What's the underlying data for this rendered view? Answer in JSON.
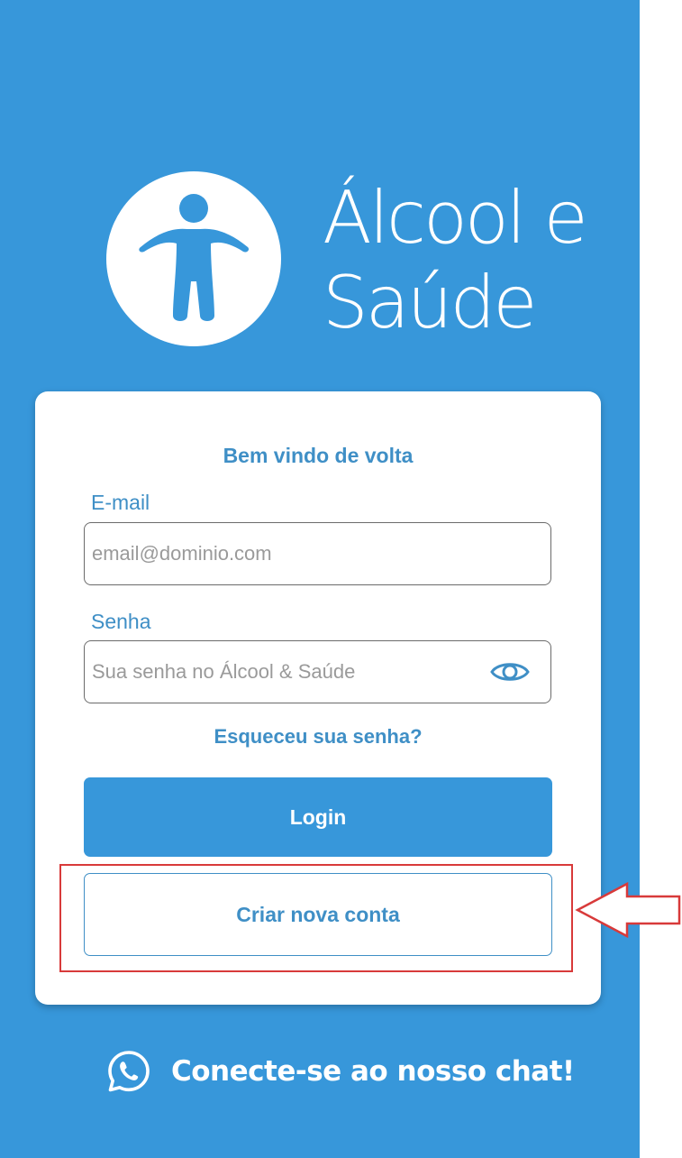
{
  "app": {
    "logo_line1": "Álcool e",
    "logo_line2": "Saúde"
  },
  "login_card": {
    "welcome": "Bem vindo de volta",
    "email_label": "E-mail",
    "email_placeholder": "email@dominio.com",
    "email_value": "",
    "password_label": "Senha",
    "password_placeholder": "Sua senha no Álcool & Saúde",
    "password_value": "",
    "password_toggle_icon": "eye-icon",
    "forgot_link": "Esqueceu sua senha?",
    "login_button": "Login",
    "create_account_button": "Criar nova conta"
  },
  "footer": {
    "chat_icon": "whatsapp-icon",
    "chat_link": "Conecte-se ao nosso chat!"
  },
  "annotation": {
    "highlight_color": "#d83a3a",
    "arrow_icon": "left-arrow-icon"
  },
  "colors": {
    "brand_blue": "#3797da",
    "text_blue": "#3f8fc6",
    "white": "#ffffff"
  }
}
